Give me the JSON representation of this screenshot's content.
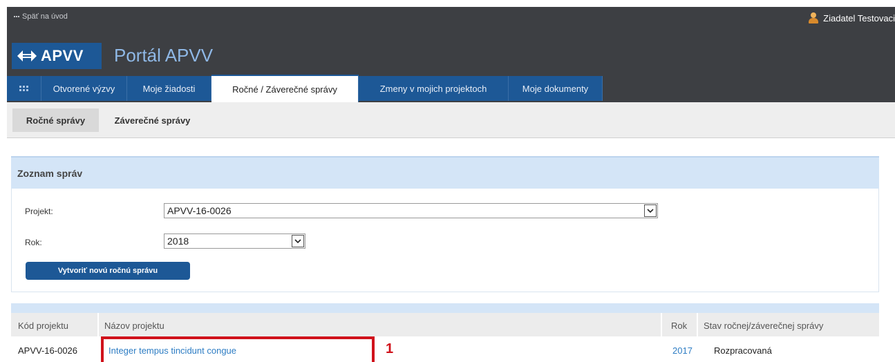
{
  "topbar": {
    "back_label": "Späť na úvod",
    "user_name": "Ziadatel Testovaci"
  },
  "header": {
    "logo_text": "APVV",
    "portal_title": "Portál APVV"
  },
  "nav": {
    "tabs": [
      {
        "label": "Otvorené výzvy"
      },
      {
        "label": "Moje žiadosti"
      },
      {
        "label": "Ročné / Záverečné správy"
      },
      {
        "label": "Zmeny v mojich projektoch"
      },
      {
        "label": "Moje dokumenty"
      }
    ],
    "active_tab": "Ročné / Záverečné správy"
  },
  "subnav": {
    "tabs": [
      {
        "label": "Ročné správy"
      },
      {
        "label": "Záverečné správy"
      }
    ],
    "active_tab": "Ročné správy"
  },
  "panel": {
    "title": "Zoznam správ",
    "project_label": "Projekt:",
    "project_value": "APVV-16-0026",
    "year_label": "Rok:",
    "year_value": "2018",
    "create_button": "Vytvoriť novú ročnú správu"
  },
  "table": {
    "columns": [
      "Kód projektu",
      "Názov projektu",
      "Rok",
      "Stav ročnej/záverečnej správy"
    ],
    "rows": [
      {
        "code": "APVV-16-0026",
        "name": "Integer tempus tincidunt congue",
        "year": "2017",
        "status": "Rozpracovaná"
      }
    ]
  },
  "annotation": {
    "marker": "1",
    "color": "#d0121b"
  },
  "colors": {
    "header_dark": "#3d3f43",
    "brand_blue": "#1d5896",
    "panel_blue": "#d4e5f7",
    "link": "#2e7dc4"
  }
}
